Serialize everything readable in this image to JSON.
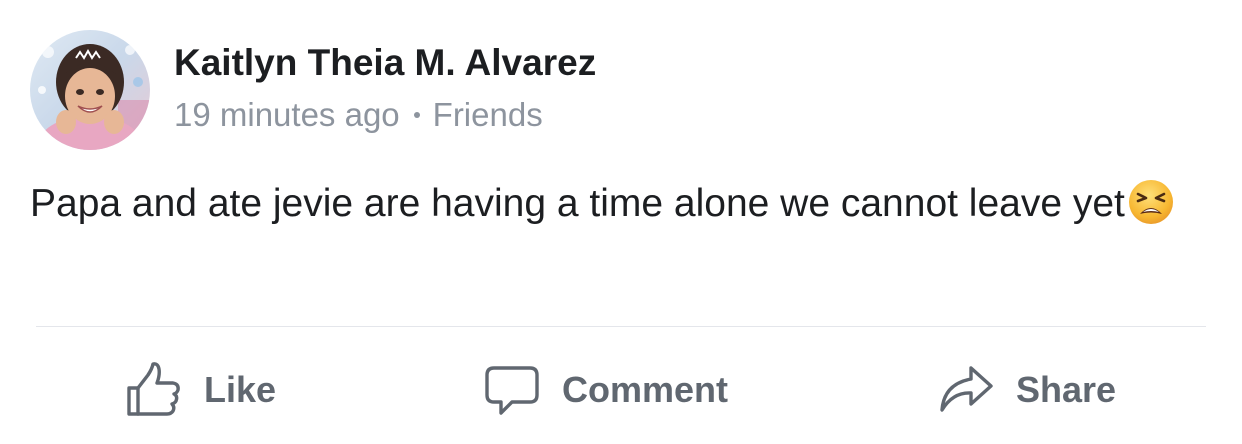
{
  "post": {
    "author_name": "Kaitlyn Theia M. Alvarez",
    "timestamp": "19 minutes ago",
    "audience": "Friends",
    "text": "Papa and ate jevie are having a time alone we cannot leave yet",
    "emoji": "tired-face-emoji"
  },
  "actions": {
    "like_label": "Like",
    "comment_label": "Comment",
    "share_label": "Share"
  },
  "icons": {
    "like": "thumbs-up-icon",
    "comment": "speech-bubble-icon",
    "share": "share-arrow-icon"
  },
  "colors": {
    "name_text": "#1c1e21",
    "secondary_text": "#8d949e",
    "action_text": "#606770",
    "divider": "#e4e6eb",
    "background": "#ffffff"
  }
}
